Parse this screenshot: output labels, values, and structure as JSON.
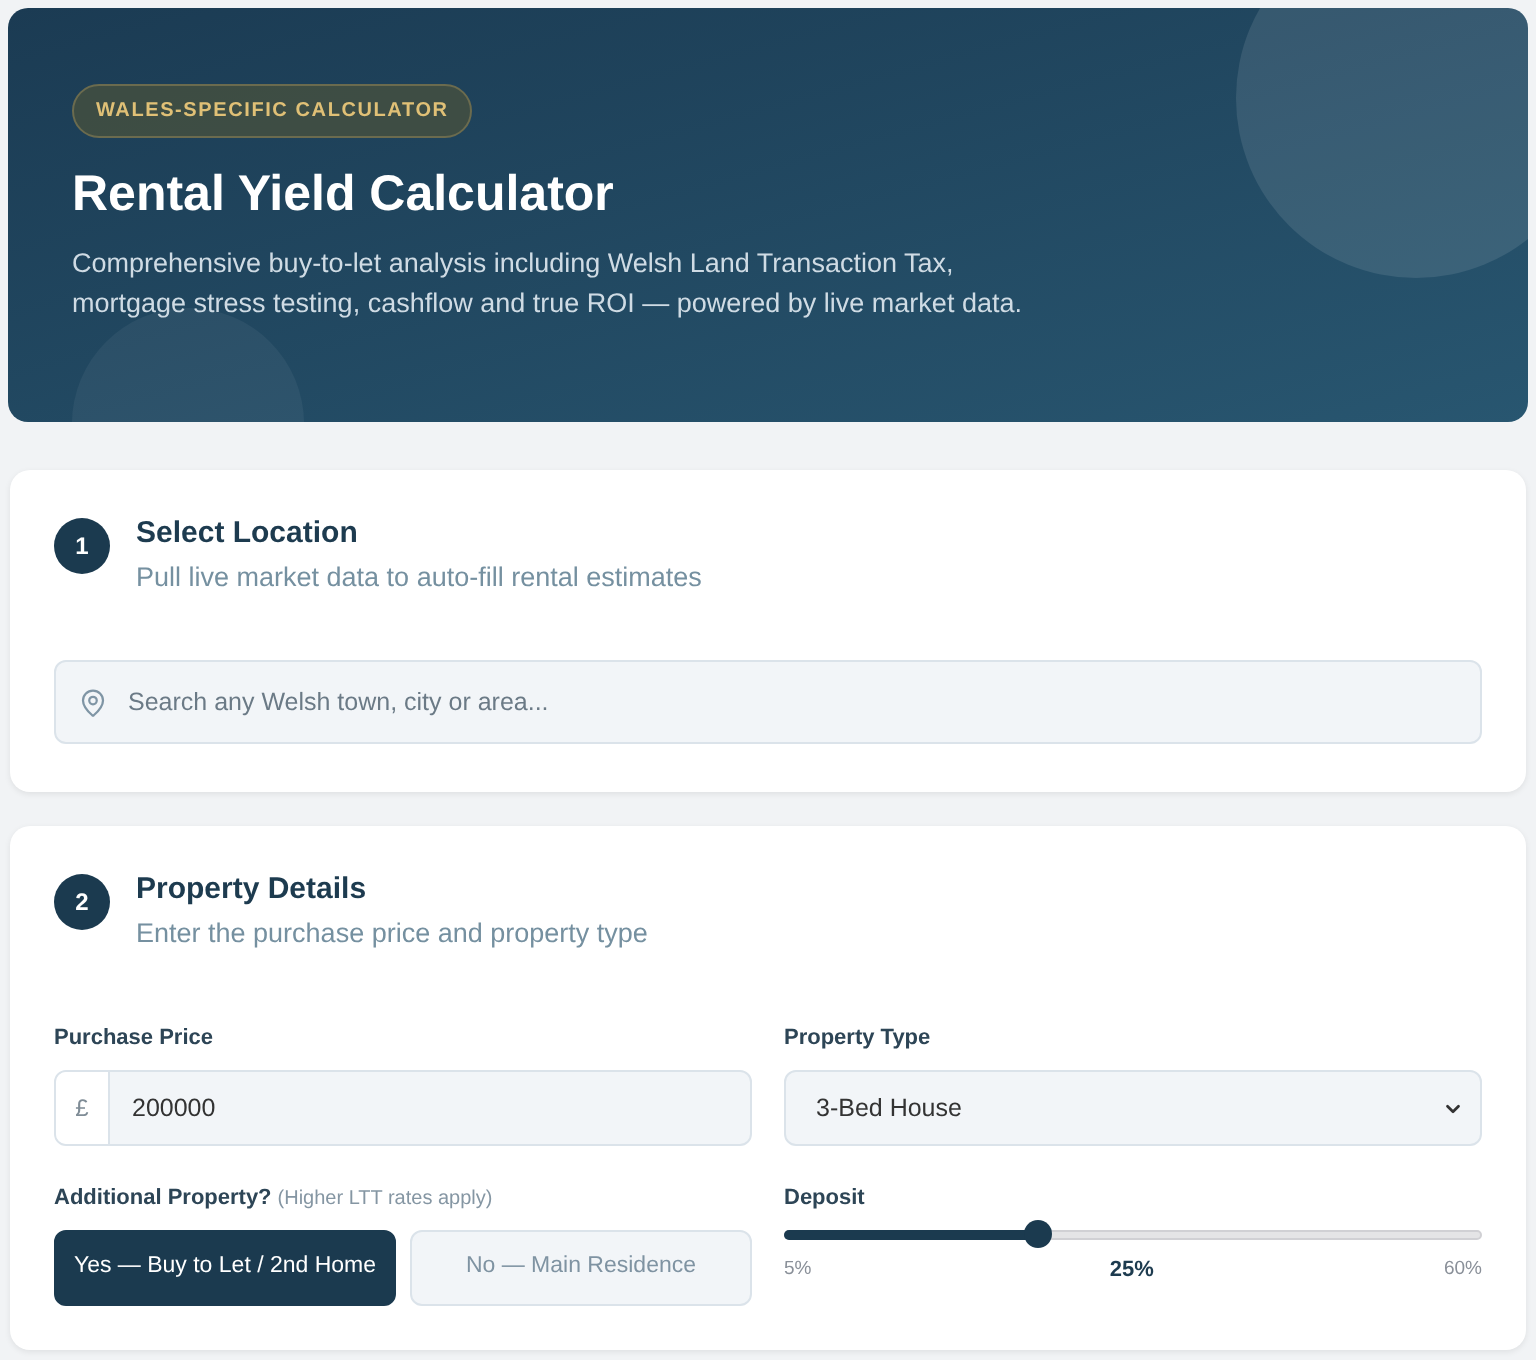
{
  "hero": {
    "badge": "WALES-SPECIFIC CALCULATOR",
    "title": "Rental Yield Calculator",
    "subtitle": "Comprehensive buy-to-let analysis including Welsh Land Transaction Tax, mortgage stress testing, cashflow and true ROI — powered by live market data."
  },
  "location_step": {
    "number": "1",
    "title": "Select Location",
    "subtitle": "Pull live market data to auto-fill rental estimates",
    "search": {
      "placeholder": "Search any Welsh town, city or area..."
    }
  },
  "property_step": {
    "number": "2",
    "title": "Property Details",
    "subtitle": "Enter the purchase price and property type",
    "purchase_price": {
      "label": "Purchase Price",
      "prefix": "£",
      "value": "200000"
    },
    "property_type": {
      "label": "Property Type",
      "value": "3-Bed House"
    },
    "additional_property": {
      "label": "Additional Property?",
      "note": "(Higher LTT rates apply)",
      "options": [
        {
          "label": "Yes — Buy to Let / 2nd Home",
          "selected": true
        },
        {
          "label": "No — Main Residence",
          "selected": false
        }
      ]
    },
    "deposit": {
      "label": "Deposit",
      "level": 0.364,
      "min_label": "5%",
      "value": "25%",
      "max_label": "60%"
    }
  }
}
